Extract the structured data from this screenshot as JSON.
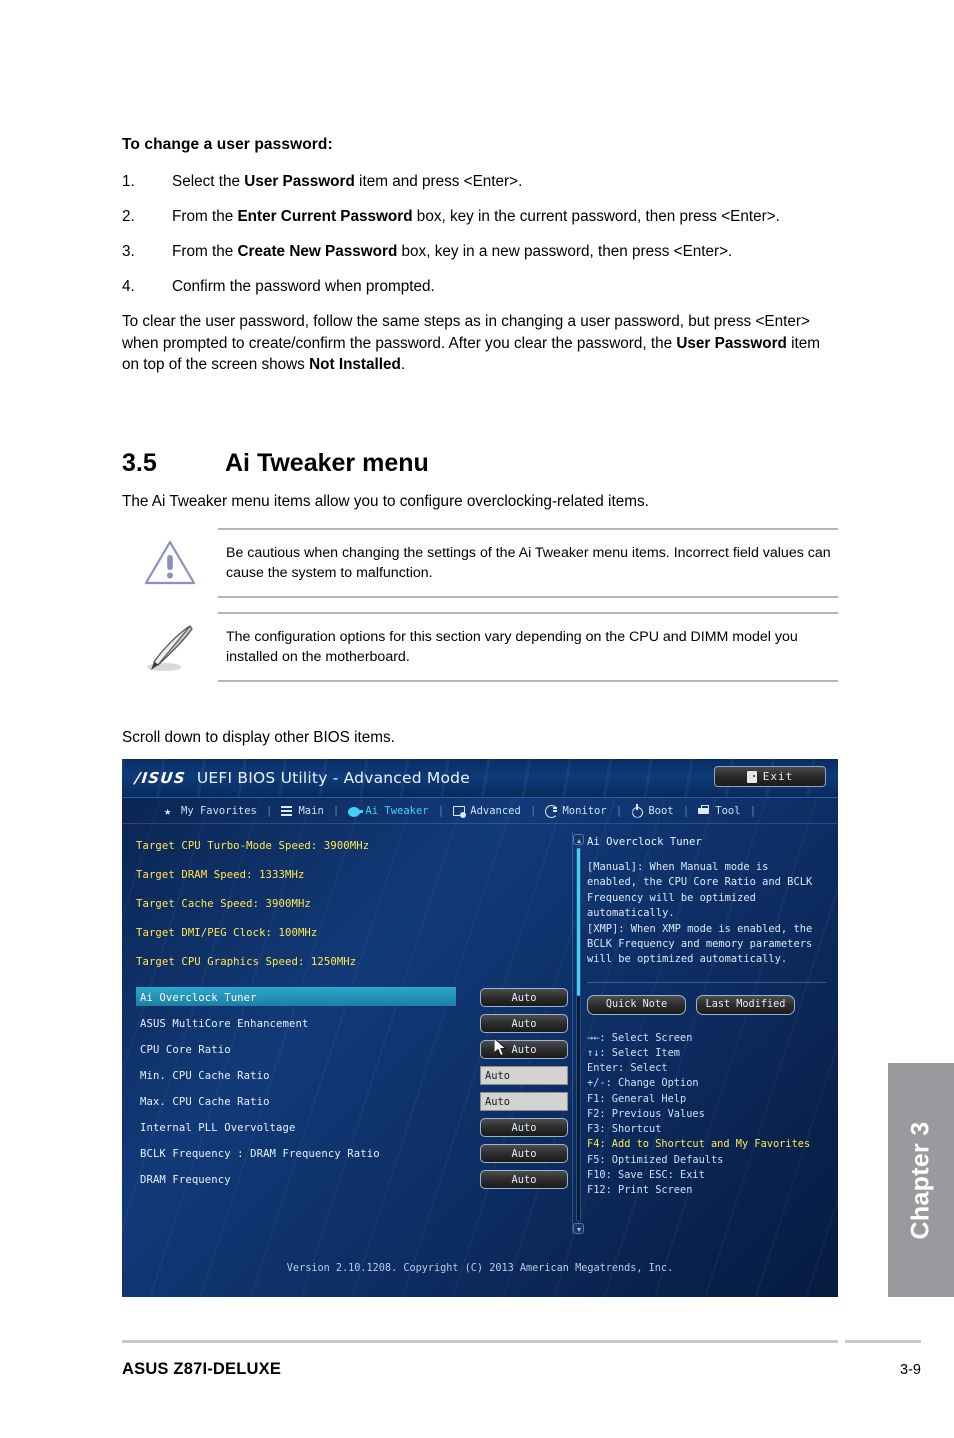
{
  "procedure": {
    "heading": "To change a user password:",
    "steps": [
      {
        "num": "1.",
        "html_parts": [
          "Select the ",
          "User Password",
          " item and press <Enter>."
        ]
      },
      {
        "num": "2.",
        "html_parts": [
          "From the ",
          "Enter Current Password",
          " box, key in the current password, then press <Enter>."
        ]
      },
      {
        "num": "3.",
        "html_parts": [
          "From the ",
          "Create New Password",
          " box, key in a new password, then press <Enter>."
        ]
      },
      {
        "num": "4.",
        "html_parts": [
          "Confirm the password when prompted.",
          "",
          ""
        ]
      }
    ],
    "closing_parts": [
      "To clear the user password, follow the same steps as in changing a user password, but press <Enter> when prompted to create/confirm the password. After you clear the password, the ",
      "User Password",
      " item on top of the screen shows ",
      "Not Installed",
      "."
    ]
  },
  "section": {
    "number": "3.5",
    "title": "Ai Tweaker menu",
    "description": "The Ai Tweaker menu items allow you to configure overclocking-related items."
  },
  "notes": [
    {
      "icon": "warning-triangle-icon",
      "text": "Be cautious when changing the settings of the Ai Tweaker menu items. Incorrect field values can cause the system to malfunction."
    },
    {
      "icon": "pencil-note-icon",
      "text": "The configuration options for this section vary depending on the CPU and DIMM model you installed on the motherboard."
    }
  ],
  "scroll_hint": "Scroll down to display other BIOS items.",
  "bios": {
    "brand": "/ISUS",
    "title": "UEFI BIOS Utility - Advanced Mode",
    "exit_label": "Exit",
    "tabs": [
      {
        "label": "My Favorites",
        "icon": "star-icon",
        "active": false
      },
      {
        "label": "Main",
        "icon": "list-icon",
        "active": false
      },
      {
        "label": "Ai Tweaker",
        "icon": "tweaker-icon",
        "active": true
      },
      {
        "label": "Advanced",
        "icon": "advanced-icon",
        "active": false
      },
      {
        "label": "Monitor",
        "icon": "monitor-icon",
        "active": false
      },
      {
        "label": "Boot",
        "icon": "power-icon",
        "active": false
      },
      {
        "label": "Tool",
        "icon": "tool-icon",
        "active": false
      }
    ],
    "info_lines": [
      "Target CPU Turbo-Mode Speed: 3900MHz",
      "Target DRAM Speed: 1333MHz",
      "Target Cache Speed: 3900MHz",
      "Target DMI/PEG Clock: 100MHz",
      "Target CPU Graphics Speed: 1250MHz"
    ],
    "options": [
      {
        "label": "Ai Overclock Tuner",
        "value": "Auto",
        "control": "button",
        "selected": true
      },
      {
        "label": "ASUS MultiCore Enhancement",
        "value": "Auto",
        "control": "button",
        "selected": false
      },
      {
        "label": "CPU Core Ratio",
        "value": "Auto",
        "control": "button",
        "selected": false
      },
      {
        "label": "Min. CPU Cache Ratio",
        "value": "Auto",
        "control": "field",
        "selected": false
      },
      {
        "label": "Max. CPU Cache Ratio",
        "value": "Auto",
        "control": "field",
        "selected": false
      },
      {
        "label": "Internal PLL Overvoltage",
        "value": "Auto",
        "control": "button",
        "selected": false
      },
      {
        "label": "BCLK Frequency : DRAM Frequency Ratio",
        "value": "Auto",
        "control": "button",
        "selected": false
      },
      {
        "label": "DRAM Frequency",
        "value": "Auto",
        "control": "button",
        "selected": false
      }
    ],
    "help": {
      "title": "Ai Overclock Tuner",
      "text": "[Manual]: When Manual mode is\nenabled, the CPU Core Ratio and BCLK\nFrequency will be optimized\nautomatically.\n[XMP]: When XMP mode is enabled, the\nBCLK Frequency and memory parameters\nwill be optimized automatically."
    },
    "quick_buttons": [
      {
        "label": "Quick Note"
      },
      {
        "label": "Last Modified"
      }
    ],
    "keys": [
      {
        "text": "→←: Select Screen",
        "highlight": false
      },
      {
        "text": "↑↓: Select Item",
        "highlight": false
      },
      {
        "text": "Enter: Select",
        "highlight": false
      },
      {
        "text": "+/-: Change Option",
        "highlight": false
      },
      {
        "text": "F1: General Help",
        "highlight": false
      },
      {
        "text": "F2: Previous Values",
        "highlight": false
      },
      {
        "text": "F3: Shortcut",
        "highlight": false
      },
      {
        "text": "F4: Add to Shortcut and My Favorites",
        "highlight": true
      },
      {
        "text": "F5: Optimized Defaults",
        "highlight": false
      },
      {
        "text": "F10: Save  ESC: Exit",
        "highlight": false
      },
      {
        "text": "F12: Print Screen",
        "highlight": false
      }
    ],
    "version": "Version 2.10.1208. Copyright (C) 2013 American Megatrends, Inc.",
    "colors": {
      "accent_cyan": "#3fd2f5",
      "info_yellow": "#ffe94f",
      "selection_teal": "#2294b8"
    }
  },
  "chapter_tab": {
    "label": "Chapter 3",
    "color": "#9a9a9e"
  },
  "footer": {
    "left": "ASUS Z87I-DELUXE",
    "right": "3-9"
  }
}
